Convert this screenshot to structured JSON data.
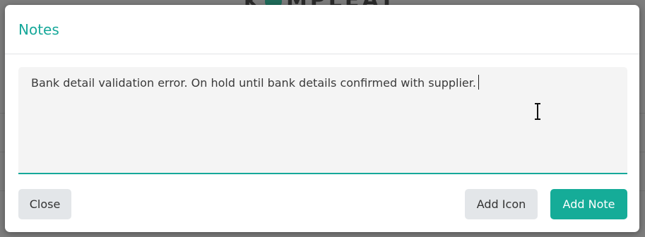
{
  "modal": {
    "title": "Notes",
    "note_text": "Bank detail validation error. On hold until bank details confirmed with supplier."
  },
  "buttons": {
    "close_label": "Close",
    "add_icon_label": "Add Icon",
    "add_note_label": "Add Note"
  },
  "colors": {
    "accent": "#16a89a",
    "primary_button": "#15ac98",
    "secondary_button": "#e3e6e9"
  },
  "icons": {
    "text_cursor": "ibeam-cursor-icon"
  }
}
